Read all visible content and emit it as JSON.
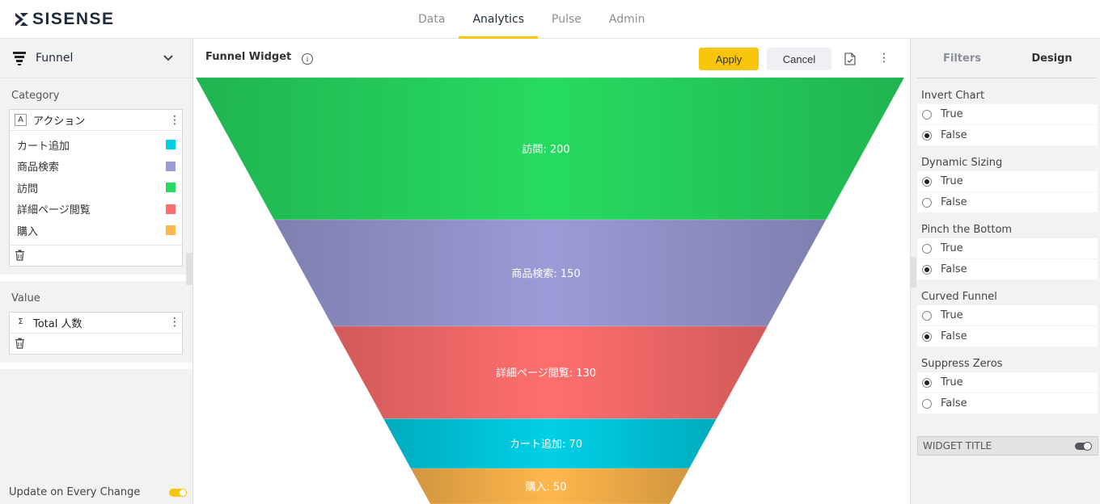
{
  "brand": {
    "name": "SISENSE"
  },
  "nav": {
    "tabs": [
      {
        "label": "Data",
        "active": false
      },
      {
        "label": "Analytics",
        "active": true
      },
      {
        "label": "Pulse",
        "active": false
      },
      {
        "label": "Admin",
        "active": false
      }
    ],
    "accent": "#f9c50a"
  },
  "left": {
    "widget_type": "Funnel",
    "category_label": "Category",
    "category_field": {
      "type_badge": "A",
      "name": "アクション"
    },
    "category_items": [
      {
        "label": "カート追加",
        "color": "#00d0e6"
      },
      {
        "label": "商品検索",
        "color": "#9b9bd7"
      },
      {
        "label": "訪問",
        "color": "#27db61"
      },
      {
        "label": "詳細ページ閲覧",
        "color": "#ff6e6e"
      },
      {
        "label": "購入",
        "color": "#ffb74d"
      }
    ],
    "value_label": "Value",
    "value_field": {
      "type_badge": "Σ",
      "name": "Total 人数"
    },
    "update_label": "Update on Every Change",
    "update_on": true
  },
  "center": {
    "widget_title": "Funnel Widget",
    "apply_label": "Apply",
    "cancel_label": "Cancel"
  },
  "chart_data": {
    "type": "funnel",
    "stages": [
      {
        "label": "訪問",
        "value": 200,
        "color": "#27db61",
        "text": "訪問: 200"
      },
      {
        "label": "商品検索",
        "value": 150,
        "color": "#9b9bd7",
        "text": "商品検索: 150"
      },
      {
        "label": "詳細ページ閲覧",
        "value": 130,
        "color": "#ff6e6e",
        "text": "詳細ページ閲覧: 130"
      },
      {
        "label": "カート追加",
        "value": 70,
        "color": "#00d0e6",
        "text": "カート追加: 70"
      },
      {
        "label": "購入",
        "value": 50,
        "color": "#ffb74d",
        "text": "購入: 50"
      }
    ]
  },
  "right": {
    "tabs": [
      {
        "label": "Filters",
        "active": false
      },
      {
        "label": "Design",
        "active": true
      }
    ],
    "options": [
      {
        "title": "Invert Chart",
        "selected": "False"
      },
      {
        "title": "Dynamic Sizing",
        "selected": "True"
      },
      {
        "title": "Pinch the Bottom",
        "selected": "False"
      },
      {
        "title": "Curved Funnel",
        "selected": "False"
      },
      {
        "title": "Suppress Zeros",
        "selected": "True"
      }
    ],
    "choice_true": "True",
    "choice_false": "False",
    "widget_title_label": "WIDGET TITLE",
    "widget_title_on": false
  }
}
